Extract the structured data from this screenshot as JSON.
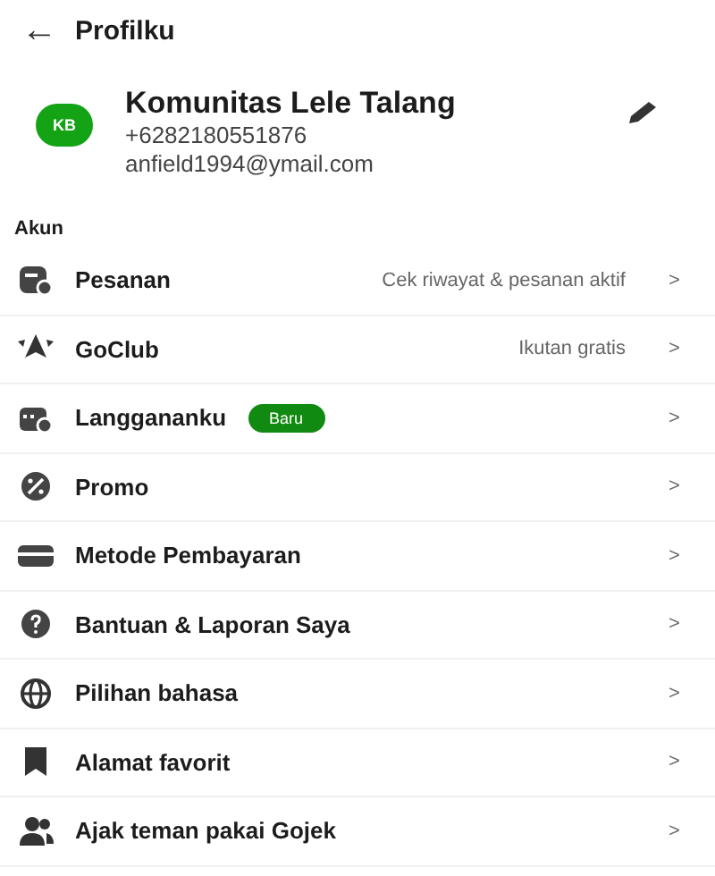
{
  "header": {
    "back": "←",
    "title": "Profilku"
  },
  "profile": {
    "initials": "KB",
    "name": "Komunitas Lele Talang",
    "phone": "+6282180551876",
    "email": "anfield1994@ymail.com"
  },
  "section": "Akun",
  "items": [
    {
      "label": "Pesanan",
      "detail": "Cek riwayat & pesanan aktif",
      "chevron": ">"
    },
    {
      "label": "GoClub",
      "detail": "Ikutan gratis",
      "chevron": ">"
    },
    {
      "label": "Langgananku",
      "badge": "Baru",
      "chevron": ">"
    },
    {
      "label": "Promo",
      "chevron": ">"
    },
    {
      "label": "Metode Pembayaran",
      "chevron": ">"
    },
    {
      "label": "Bantuan & Laporan Saya",
      "chevron": ">"
    },
    {
      "label": "Pilihan bahasa",
      "chevron": ">"
    },
    {
      "label": "Alamat favorit",
      "chevron": ">"
    },
    {
      "label": "Ajak teman pakai Gojek",
      "chevron": ">"
    }
  ]
}
